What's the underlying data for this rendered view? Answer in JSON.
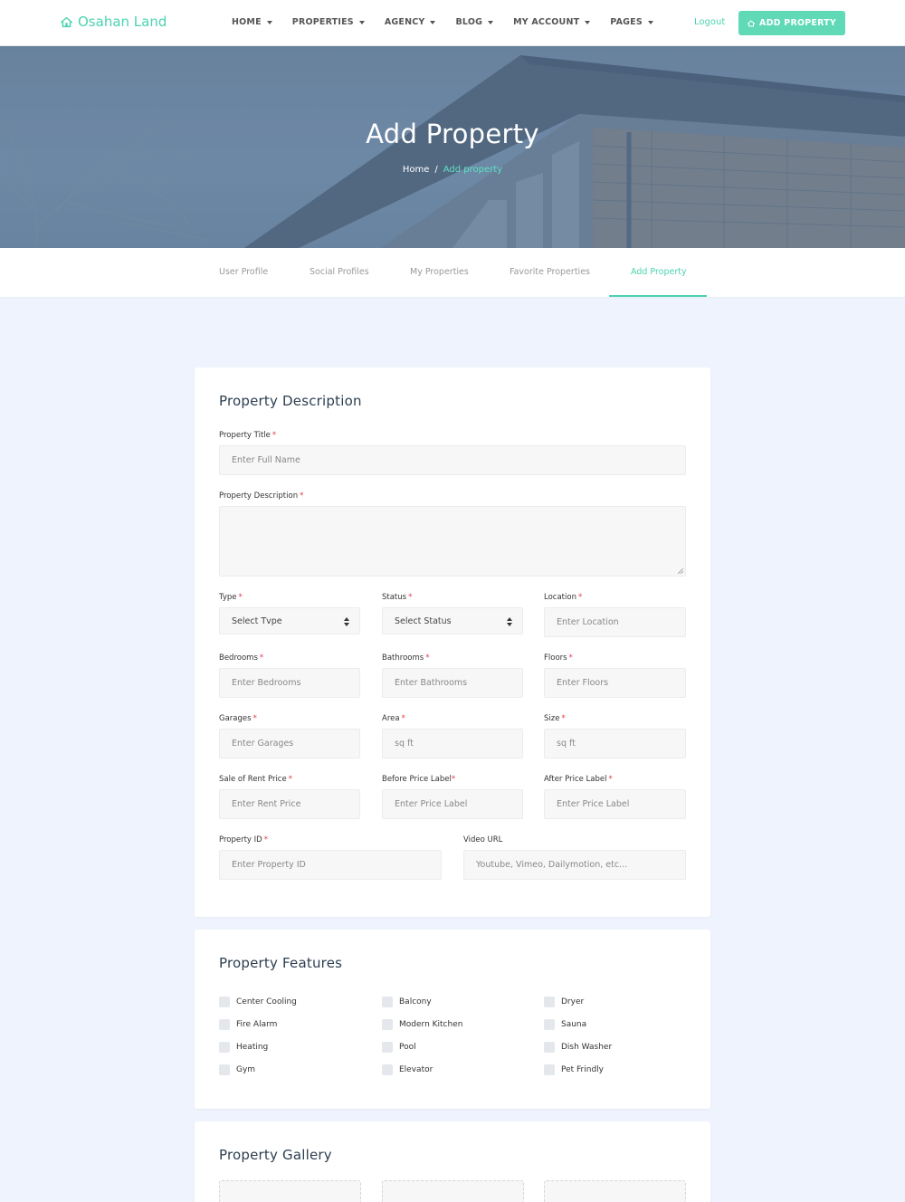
{
  "brand": {
    "name": "Osahan Land",
    "icon": "home-icon"
  },
  "nav": {
    "items": [
      {
        "label": "HOME"
      },
      {
        "label": "PROPERTIES"
      },
      {
        "label": "AGENCY"
      },
      {
        "label": "BLOG"
      },
      {
        "label": "MY ACCOUNT"
      },
      {
        "label": "PAGES"
      }
    ],
    "logout": "Logout",
    "add_property": "ADD PROPERTY"
  },
  "hero": {
    "title": "Add Property",
    "breadcrumb": {
      "home": "Home",
      "separator": "/",
      "current": "Add property"
    }
  },
  "tabs": [
    {
      "label": "User Profile"
    },
    {
      "label": "Social Profiles"
    },
    {
      "label": "My Properties"
    },
    {
      "label": "Favorite Properties"
    },
    {
      "label": "Add Property",
      "active": true
    }
  ],
  "description_card": {
    "title": "Property Description",
    "fields": {
      "title": {
        "label": "Property Title",
        "placeholder": "Enter Full Name"
      },
      "description": {
        "label": "Property Description",
        "placeholder": ""
      },
      "type": {
        "label": "Type",
        "value": "Select Tvpe"
      },
      "status": {
        "label": "Status",
        "value": "Select Status"
      },
      "location": {
        "label": "Location",
        "placeholder": "Enter Location"
      },
      "bedrooms": {
        "label": "Bedrooms",
        "placeholder": "Enter Bedrooms"
      },
      "bathrooms": {
        "label": "Bathrooms",
        "placeholder": "Enter Bathrooms"
      },
      "floors": {
        "label": "Floors",
        "placeholder": "Enter Floors"
      },
      "garages": {
        "label": "Garages",
        "placeholder": "Enter Garages"
      },
      "area": {
        "label": "Area",
        "placeholder": "sq ft"
      },
      "size": {
        "label": "Size",
        "placeholder": "sq ft"
      },
      "rent_price": {
        "label": "Sale of Rent Price",
        "placeholder": "Enter Rent Price"
      },
      "before_price": {
        "label": "Before Price Label",
        "placeholder": "Enter Price Label"
      },
      "after_price": {
        "label": "After Price Label",
        "placeholder": "Enter Price Label"
      },
      "property_id": {
        "label": "Property ID",
        "placeholder": "Enter Property ID"
      },
      "video_url": {
        "label": "Video URL",
        "placeholder": "Youtube, Vimeo, Dailymotion, etc..."
      }
    },
    "required_mark": "*"
  },
  "features_card": {
    "title": "Property Features",
    "columns": [
      [
        "Center Cooling",
        "Fire Alarm",
        "Heating",
        "Gym"
      ],
      [
        "Balcony",
        "Modern Kitchen",
        "Pool",
        "Elevator"
      ],
      [
        "Dryer",
        "Sauna",
        "Dish Washer",
        "Pet Frindly"
      ]
    ]
  },
  "gallery_card": {
    "title": "Property Gallery"
  },
  "colors": {
    "accent": "#4cd3b0",
    "button": "#5fd9b6",
    "page_bg": "#eef3fd",
    "required": "#e0384a"
  }
}
